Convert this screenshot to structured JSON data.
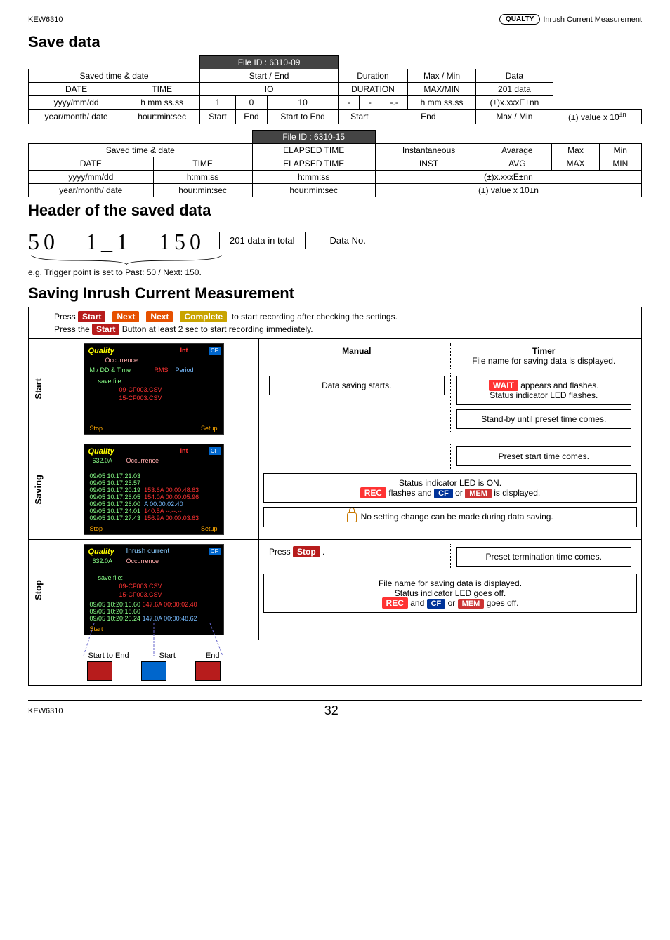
{
  "topbar": {
    "left": "KEW6310",
    "oval": "QUALTY",
    "right": "Inrush Current Measurement"
  },
  "save_title": "Save data",
  "table1": {
    "fileid": "File ID : 6310-09",
    "row_titles": [
      "Saved time & date",
      "Start / End",
      "Duration",
      "Max / Min",
      "Data"
    ],
    "row2": [
      "DATE",
      "TIME",
      "IO",
      "DURATION",
      "MAX/MIN",
      "201 data"
    ],
    "row3": [
      "yyyy/mm/dd",
      "h mm ss.ss",
      "1",
      "0",
      "10",
      "-",
      "-",
      "-.-",
      "h mm ss.ss",
      "(±)x.xxxE±nn"
    ],
    "row4": [
      "year/month/ date",
      "hour:min:sec",
      "Start",
      "End",
      "Start to End",
      "Start",
      "End",
      "Max / Min",
      "(±) value x 10"
    ]
  },
  "table2": {
    "fileid": "File ID : 6310-15",
    "row1": [
      "Saved time & date",
      "ELAPSED TIME",
      "Instantaneous",
      "Avarage",
      "Max",
      "Min"
    ],
    "row2": [
      "DATE",
      "TIME",
      "ELAPSED TIME",
      "INST",
      "AVG",
      "MAX",
      "MIN"
    ],
    "row3": [
      "yyyy/mm/dd",
      "h:mm:ss",
      "h:mm:ss",
      "(±)x.xxxE±nn"
    ],
    "row4": [
      "year/month/ date",
      "hour:min:sec",
      "hour:min:sec",
      "(±) value x 10±n"
    ]
  },
  "header_saved": "Header of the saved data",
  "bignum": "50　1_1　150",
  "box1": "201 data in total",
  "box2": "Data No.",
  "note": "e.g. Trigger point is set to Past: 50 / Next: 150.",
  "sim_title": "Saving Inrush Current Measurement",
  "press_row": {
    "p": "Press",
    "start": "Start",
    "next1": "Next",
    "next2": "Next",
    "complete": "Complete",
    "tail": "to start recording after checking the settings."
  },
  "press_row2": "Press the        Button at least 2 sec to start recording immediately.",
  "press_row2_start": "Start",
  "stages": {
    "start": "Start",
    "saving": "Saving",
    "stop": "Stop"
  },
  "stage1": {
    "manual": "Manual",
    "timer": "Timer",
    "l1": "File name for saving data is displayed.",
    "l2": "Data saving starts.",
    "l3": "appears and flashes.",
    "l3b": "Status indicator LED flashes.",
    "l4": "Stand-by until preset time comes."
  },
  "stage2": {
    "r1": "Preset start time comes.",
    "r2a": "Status indicator LED is ON.",
    "r2b": "flashes and",
    "r2c": "or",
    "r2d": "is displayed.",
    "r3": "No setting change can be made during data saving."
  },
  "stage3": {
    "l1a": "Press",
    "l1b": "Stop",
    "l1c": ".",
    "r1": "Preset termination time comes.",
    "r2": "File name for saving data is displayed.",
    "r3": "Status indicator LED goes off.",
    "r4a": "and",
    "r4b": "or",
    "r4c": "goes off."
  },
  "startend": {
    "a": "Start to End",
    "b": "Start",
    "c": "End"
  },
  "shot": {
    "quality": "Quality",
    "occur": "Occurrence",
    "stop": "Stop",
    "setup": "Setup",
    "rms": "RMS",
    "period": "Period",
    "start": "Start",
    "savefile": "save file:",
    "f1": "09-CF003.CSV",
    "f2": "15-CF003.CSV",
    "f3": "632.0A",
    "f4": "647.6A 00:00:02.40",
    "inrush": "Inrush current"
  },
  "chip": {
    "orec": "REC",
    "cf": "CF",
    "mem": "MEM",
    "wait": "WAIT",
    "int": "Int"
  },
  "footer": {
    "l": "KEW6310",
    "r": "32"
  }
}
